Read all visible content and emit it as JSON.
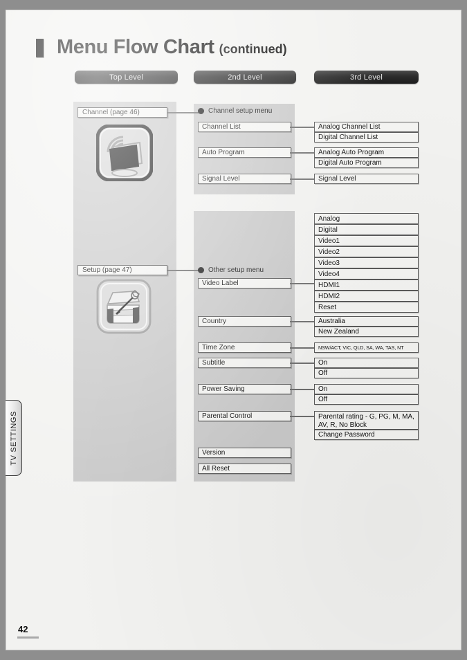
{
  "header": {
    "title": "Menu Flow Chart",
    "subtitle": "(continued)"
  },
  "column_headers": [
    {
      "label": "Top Level"
    },
    {
      "label": "2nd Level"
    },
    {
      "label": "3rd Level"
    }
  ],
  "side_tab": {
    "label": "TV SETTINGS"
  },
  "footer": {
    "page_number": "42"
  },
  "sections": [
    {
      "id": "channel",
      "top_level": {
        "label": "Channel (page 46)",
        "icon": "tv-antenna-icon"
      },
      "second_level_heading": "Channel setup menu",
      "items": [
        {
          "label": "Channel List",
          "children": [
            "Analog Channel List",
            "Digital Channel List"
          ]
        },
        {
          "label": "Auto Program",
          "children": [
            "Analog Auto Program",
            "Digital Auto Program"
          ]
        },
        {
          "label": "Signal Level",
          "children": [
            "Signal Level"
          ]
        }
      ]
    },
    {
      "id": "setup",
      "top_level": {
        "label": "Setup (page 47)",
        "icon": "toolbox-wrench-icon"
      },
      "second_level_heading": "Other setup menu",
      "items": [
        {
          "label": "Video Label",
          "children": [
            "Analog",
            "Digital",
            "Video1",
            "Video2",
            "Video3",
            "Video4",
            "HDMI1",
            "HDMI2",
            "Reset"
          ]
        },
        {
          "label": "Country",
          "children": [
            "Australia",
            "New Zealand"
          ]
        },
        {
          "label": "Time Zone",
          "children": [
            "NSW/ACT, VIC, QLD, SA, WA, TAS, NT"
          ]
        },
        {
          "label": "Subtitle",
          "children": [
            "On",
            "Off"
          ]
        },
        {
          "label": "Power Saving",
          "children": [
            "On",
            "Off"
          ]
        },
        {
          "label": "Parental Control",
          "children": [
            "Parental rating - G, PG, M, MA, AV, R, No Block",
            "Change Password"
          ]
        },
        {
          "label": "Version",
          "children": []
        },
        {
          "label": "All Reset",
          "children": []
        }
      ]
    }
  ],
  "boxes": {
    "channel_top": "Channel (page 46)",
    "setup_top": "Setup (page 47)",
    "channel_setup_menu": "Channel setup menu",
    "other_setup_menu": "Other setup menu",
    "channel_list": "Channel List",
    "auto_program": "Auto Program",
    "signal_level": "Signal Level",
    "analog_channel_list": "Analog Channel List",
    "digital_channel_list": "Digital Channel List",
    "analog_auto_program": "Analog Auto Program",
    "digital_auto_program": "Digital Auto Program",
    "signal_level_3": "Signal Level",
    "video_label": "Video Label",
    "vl_analog": "Analog",
    "vl_digital": "Digital",
    "vl_video1": "Video1",
    "vl_video2": "Video2",
    "vl_video3": "Video3",
    "vl_video4": "Video4",
    "vl_hdmi1": "HDMI1",
    "vl_hdmi2": "HDMI2",
    "vl_reset": "Reset",
    "country": "Country",
    "country_au": "Australia",
    "country_nz": "New Zealand",
    "time_zone": "Time Zone",
    "time_zone_val": "NSW/ACT, VIC, QLD, SA, WA, TAS, NT",
    "subtitle": "Subtitle",
    "subtitle_on": "On",
    "subtitle_off": "Off",
    "power_saving": "Power Saving",
    "power_on": "On",
    "power_off": "Off",
    "parental_control": "Parental Control",
    "parental_rating": "Parental rating - G, PG, M, MA, AV, R, No Block",
    "change_password": "Change Password",
    "version": "Version",
    "all_reset": "All Reset"
  }
}
